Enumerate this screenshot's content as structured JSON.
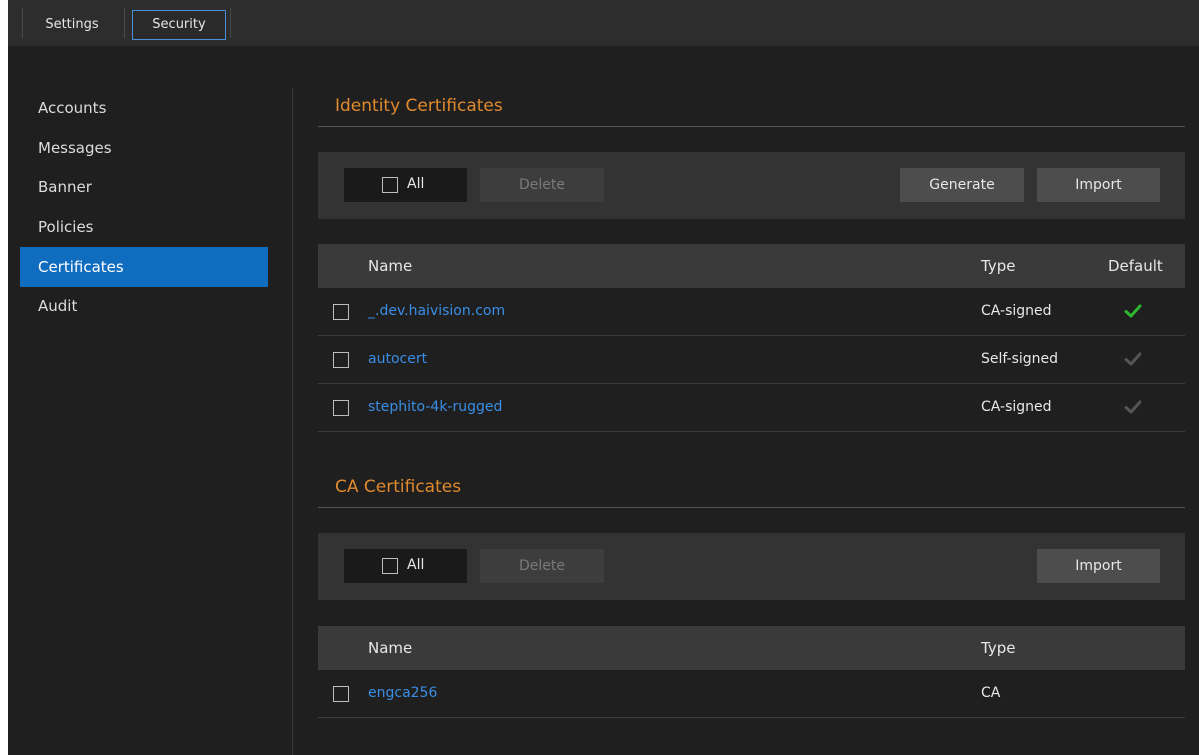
{
  "topbar": {
    "tabs": [
      {
        "label": "Settings"
      },
      {
        "label": "Security",
        "active": true
      }
    ]
  },
  "sidebar": {
    "items": [
      {
        "label": "Accounts"
      },
      {
        "label": "Messages"
      },
      {
        "label": "Banner"
      },
      {
        "label": "Policies"
      },
      {
        "label": "Certificates",
        "active": true
      },
      {
        "label": "Audit"
      }
    ]
  },
  "identity": {
    "title": "Identity Certificates",
    "toolbar": {
      "all_label": "All",
      "delete_label": "Delete",
      "generate_label": "Generate",
      "import_label": "Import"
    },
    "columns": {
      "name": "Name",
      "type": "Type",
      "default": "Default"
    },
    "rows": [
      {
        "name": "_.dev.haivision.com",
        "type": "CA-signed",
        "default": true
      },
      {
        "name": "autocert",
        "type": "Self-signed",
        "default": false
      },
      {
        "name": "stephito-4k-rugged",
        "type": "CA-signed",
        "default": false
      }
    ]
  },
  "ca": {
    "title": "CA Certificates",
    "toolbar": {
      "all_label": "All",
      "delete_label": "Delete",
      "import_label": "Import"
    },
    "columns": {
      "name": "Name",
      "type": "Type"
    },
    "rows": [
      {
        "name": "engca256",
        "type": "CA"
      }
    ]
  },
  "colors": {
    "accent_orange": "#e08a2e",
    "link_blue": "#3a8ee6",
    "active_blue": "#0f6cbf",
    "check_green": "#2fb52f",
    "check_gray": "#555555"
  }
}
